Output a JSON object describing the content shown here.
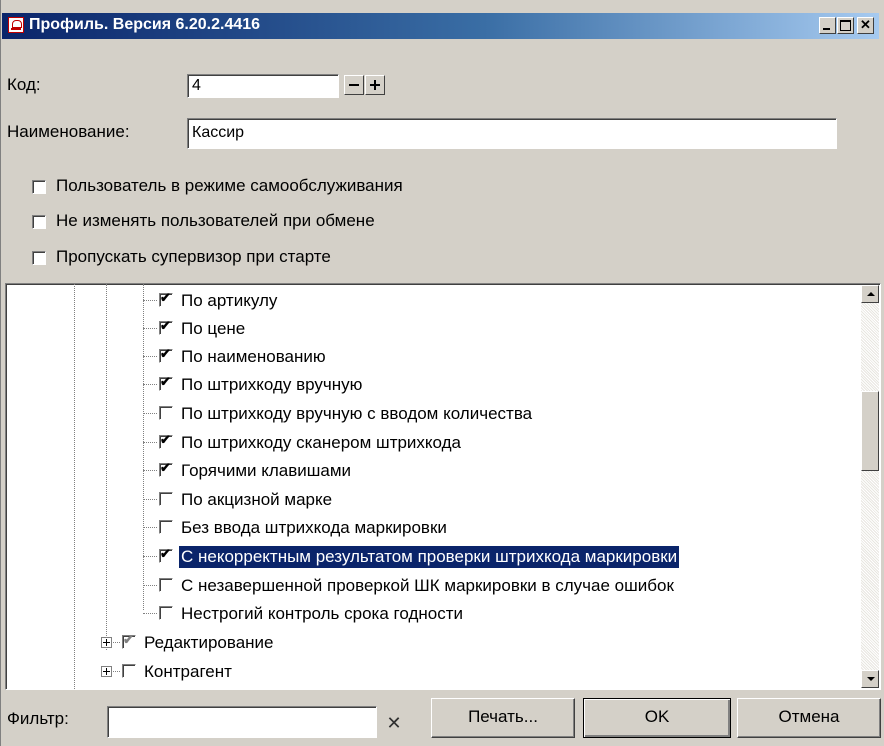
{
  "window": {
    "title": "Профиль. Версия 6.20.2.4416",
    "title_bar_color": "#0a246a",
    "icon": "profile-app-icon"
  },
  "form": {
    "code_label": "Код:",
    "code_value": "4",
    "name_label": "Наименование:",
    "name_value": "Кассир"
  },
  "options": [
    {
      "label": "Пользователь в режиме самообслуживания",
      "checked": false
    },
    {
      "label": "Не изменять пользователей при обмене",
      "checked": false
    },
    {
      "label": "Пропускать супервизор при старте",
      "checked": false
    }
  ],
  "tree": {
    "children": [
      {
        "label": "По артикулу",
        "checked": true
      },
      {
        "label": "По цене",
        "checked": true
      },
      {
        "label": "По наименованию",
        "checked": true
      },
      {
        "label": "По штрихкоду вручную",
        "checked": true
      },
      {
        "label": "По штрихкоду вручную с вводом количества",
        "checked": false
      },
      {
        "label": "По штрихкоду сканером штрихкода",
        "checked": true
      },
      {
        "label": "Горячими клавишами",
        "checked": true
      },
      {
        "label": "По акцизной марке",
        "checked": false
      },
      {
        "label": "Без ввода штрихкода маркировки",
        "checked": false
      },
      {
        "label": "С некорректным результатом проверки штрихкода маркировки",
        "checked": true,
        "selected": true
      },
      {
        "label": "С незавершенной проверкой ШК маркировки в случае ошибок",
        "checked": false
      },
      {
        "label": "Нестрогий контроль срока годности",
        "checked": false
      }
    ],
    "parents": [
      {
        "label": "Редактирование",
        "checked": "partial"
      },
      {
        "label": "Контрагент",
        "checked": false
      }
    ],
    "selection_color": "#0a246a"
  },
  "footer": {
    "filter_label": "Фильтр:",
    "filter_value": "",
    "clear_glyph": "✕",
    "print_label": "Печать...",
    "ok_label": "OK",
    "cancel_label": "Отмена"
  }
}
